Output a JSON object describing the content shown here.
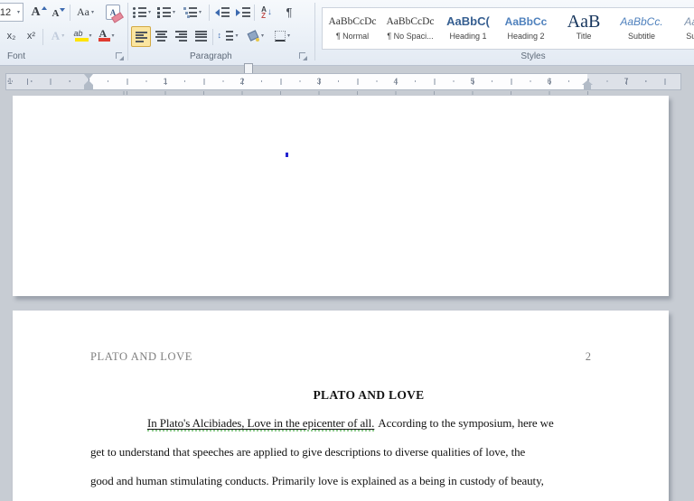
{
  "icons": {
    "caret": "▾",
    "sort_arrow": "↓",
    "spacing_arrows": "↕",
    "pilcrow": "¶"
  },
  "ribbon": {
    "font": {
      "label": "Font",
      "size_value": "12",
      "grow_glyph": "A",
      "shrink_glyph": "A",
      "change_case": "Aa",
      "clear_glyph": "A",
      "subscript": "x₂",
      "superscript": "x²",
      "effects_glyph": "A",
      "highlight_glyph": "ab",
      "color_glyph": "A"
    },
    "paragraph": {
      "label": "Paragraph",
      "sort_a": "A",
      "sort_z": "Z"
    },
    "styles": {
      "label": "Styles",
      "items": [
        {
          "sample": "AaBbCcDc",
          "name": "¶ Normal"
        },
        {
          "sample": "AaBbCcDc",
          "name": "¶ No Spaci..."
        },
        {
          "sample": "AaBbC(",
          "name": "Heading 1"
        },
        {
          "sample": "AaBbCc",
          "name": "Heading 2"
        },
        {
          "sample": "AaB",
          "name": "Title"
        },
        {
          "sample": "AaBbCc.",
          "name": "Subtitle"
        },
        {
          "sample": "AaBb",
          "name": "Subtle"
        }
      ]
    }
  },
  "ruler": {
    "margin_number": "1",
    "inches": [
      "1",
      "2",
      "3",
      "4",
      "5",
      "6",
      "7"
    ]
  },
  "document": {
    "header": "PLATO AND LOVE",
    "page_number": "2",
    "title": "PLATO AND LOVE",
    "line1_underlined": "In Plato's Alcibiades, Love in the epicenter of all.",
    "line1_rest": "According to the symposium, here we",
    "line2": "get to understand that speeches are applied to give descriptions to diverse qualities of love, the",
    "line3": "good and human stimulating conducts. Primarily love is explained as a being in custody of beauty,"
  }
}
